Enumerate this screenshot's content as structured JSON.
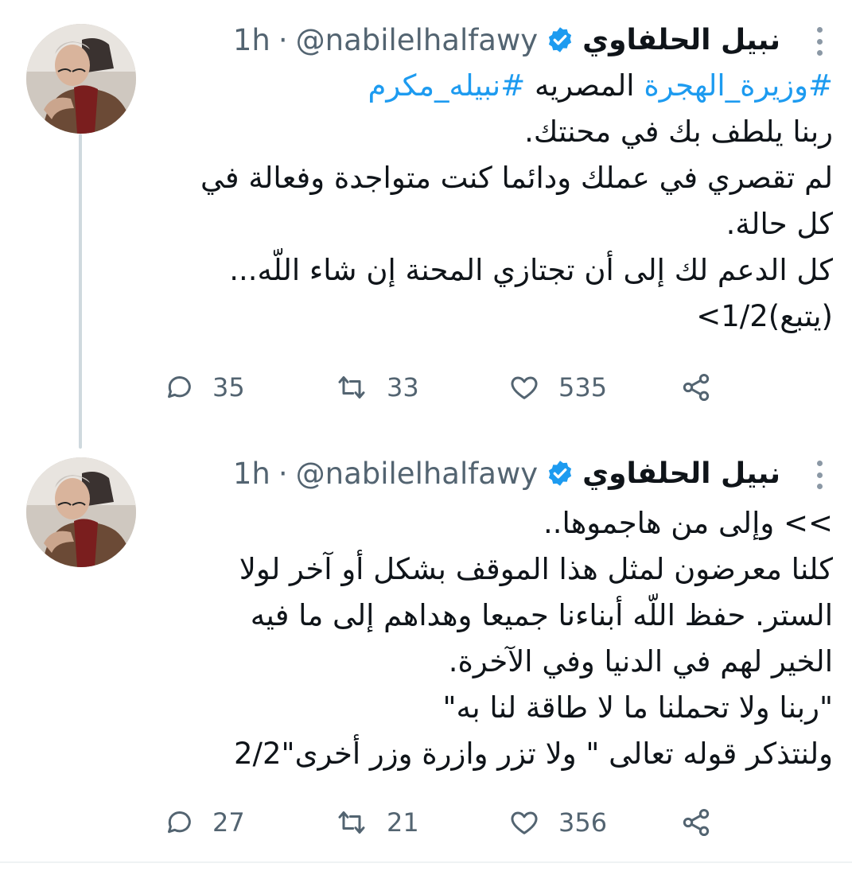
{
  "tweets": [
    {
      "author_name": "نبيل الحلفاوي",
      "handle": "@nabilelhalfawy",
      "separator": "·",
      "time": "1h",
      "hashtag_1": "#وزيرة_الهجرة",
      "hashtag_text": "المصريه",
      "hashtag_2": "#نبيله_مكرم",
      "lines": [
        "ربنا يلطف بك في محنتك.",
        "لم تقصري في عملك ودائما كنت متواجدة وفعالة في",
        "كل حالة.",
        "كل الدعم لك إلى أن تجتازي المحنة إن شاء اللّه...",
        "(يتبع)1/2>"
      ],
      "replies": "35",
      "retweets": "33",
      "likes": "535"
    },
    {
      "author_name": "نبيل الحلفاوي",
      "handle": "@nabilelhalfawy",
      "separator": "·",
      "time": "1h",
      "lines": [
        ">> وإلى من هاجموها..",
        "كلنا معرضون لمثل هذا الموقف بشكل أو آخر لولا",
        "الستر. حفظ اللّه أبناءنا جميعا وهداهم إلى ما فيه",
        "الخير لهم في الدنيا وفي الآخرة.",
        "\"ربنا ولا تحملنا ما لا طاقة لنا به\"",
        "ولنتذكر قوله تعالى \" ولا تزر وازرة وزر أخرى\"2/2"
      ],
      "replies": "27",
      "retweets": "21",
      "likes": "356"
    }
  ],
  "icons": {
    "reply": "reply-icon",
    "retweet": "retweet-icon",
    "like": "heart-icon",
    "share": "share-icon",
    "verified": "verified-badge-icon",
    "more": "more-vertical-icon"
  },
  "colors": {
    "accent": "#1d9bf0",
    "secondary_text": "#536471",
    "thread_line": "#cfd9de"
  }
}
